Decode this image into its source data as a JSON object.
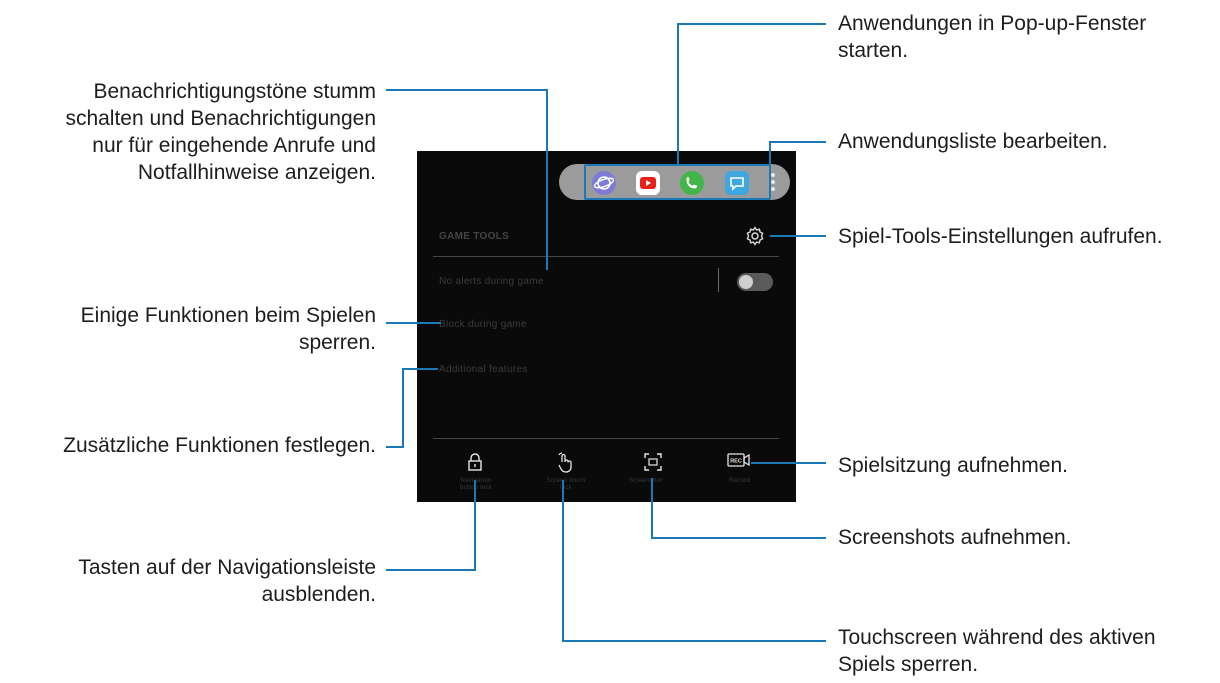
{
  "callouts": {
    "popup": [
      "Anwendungen in Pop-up-Fenster",
      "starten."
    ],
    "notifications": [
      "Benachrichtigungstöne stumm",
      "schalten und Benachrichtigungen",
      "nur für eingehende Anrufe und",
      "Notfallhinweise anzeigen."
    ],
    "edit_list": "Anwendungsliste bearbeiten.",
    "settings": "Spiel-Tools-Einstellungen aufrufen.",
    "block": [
      "Einige Funktionen beim Spielen",
      "sperren."
    ],
    "additional": "Zusätzliche Funktionen festlegen.",
    "record": "Spielsitzung aufnehmen.",
    "screenshot": "Screenshots aufnehmen.",
    "navbar": [
      "Tasten auf der Navigationsleiste",
      "ausblenden."
    ],
    "touchlock": [
      "Touchscreen während des aktiven",
      "Spiels sperren."
    ]
  },
  "phone": {
    "header": "GAME TOOLS",
    "menu": [
      "No alerts during game",
      "Block during game",
      "Additional features"
    ],
    "tools": [
      "Navigation button lock",
      "Screen touch lock",
      "Screenshot",
      "Record"
    ],
    "app_icons": [
      "samsung-internet-icon",
      "youtube-icon",
      "phone-icon",
      "messages-icon"
    ]
  },
  "colors": {
    "leader": "#1b7ab5",
    "screen": "#0a0a0a",
    "app_bar": "#9b9b9b"
  }
}
